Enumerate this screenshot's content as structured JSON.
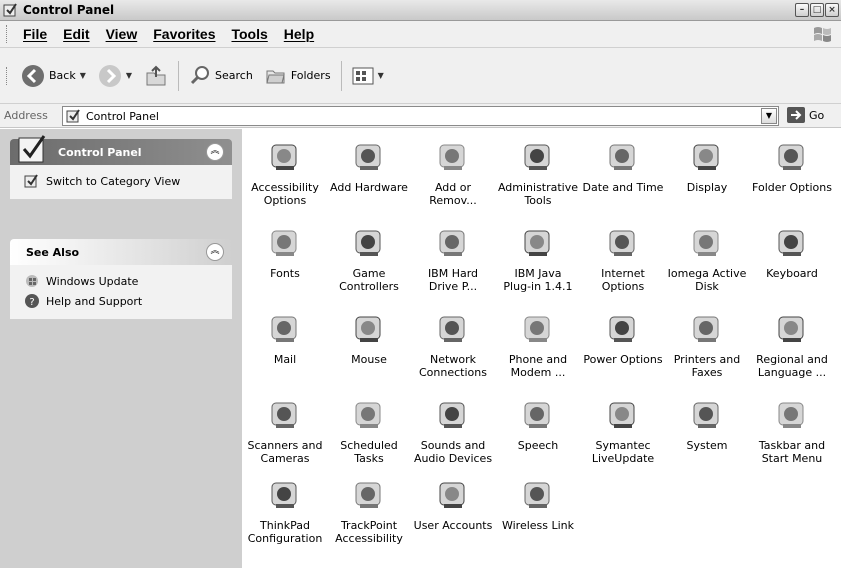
{
  "window": {
    "title": "Control Panel"
  },
  "menu": [
    "File",
    "Edit",
    "View",
    "Favorites",
    "Tools",
    "Help"
  ],
  "toolbar": {
    "back": "Back",
    "search": "Search",
    "folders": "Folders"
  },
  "address": {
    "label": "Address",
    "value": "Control Panel",
    "go": "Go"
  },
  "left": {
    "cp_title": "Control Panel",
    "switch_view": "Switch to Category View",
    "see_also": "See Also",
    "links": [
      "Windows Update",
      "Help and Support"
    ]
  },
  "items": [
    [
      "Accessibility",
      "Options"
    ],
    [
      "Add Hardware",
      ""
    ],
    [
      "Add or",
      "Remov..."
    ],
    [
      "Administrative",
      "Tools"
    ],
    [
      "Date and Time",
      ""
    ],
    [
      "Display",
      ""
    ],
    [
      "Folder Options",
      ""
    ],
    [
      "Fonts",
      ""
    ],
    [
      "Game",
      "Controllers"
    ],
    [
      "IBM Hard",
      "Drive P..."
    ],
    [
      "IBM Java",
      "Plug-in 1.4.1"
    ],
    [
      "Internet",
      "Options"
    ],
    [
      "Iomega Active",
      "Disk"
    ],
    [
      "Keyboard",
      ""
    ],
    [
      "Mail",
      ""
    ],
    [
      "Mouse",
      ""
    ],
    [
      "Network",
      "Connections"
    ],
    [
      "Phone and",
      "Modem ..."
    ],
    [
      "Power Options",
      ""
    ],
    [
      "Printers and",
      "Faxes"
    ],
    [
      "Regional and",
      "Language ..."
    ],
    [
      "Scanners and",
      "Cameras"
    ],
    [
      "Scheduled",
      "Tasks"
    ],
    [
      "Sounds and",
      "Audio Devices"
    ],
    [
      "Speech",
      ""
    ],
    [
      "Symantec",
      "LiveUpdate"
    ],
    [
      "System",
      ""
    ],
    [
      "Taskbar and",
      "Start Menu"
    ],
    [
      "ThinkPad",
      "Configuration"
    ],
    [
      "TrackPoint",
      "Accessibility"
    ],
    [
      "User Accounts",
      ""
    ],
    [
      "Wireless Link",
      ""
    ]
  ],
  "icon_names": [
    "accessibility-icon",
    "add-hardware-icon",
    "add-remove-programs-icon",
    "administrative-tools-icon",
    "date-time-icon",
    "display-icon",
    "folder-options-icon",
    "fonts-icon",
    "game-controllers-icon",
    "ibm-hard-drive-icon",
    "ibm-java-icon",
    "internet-options-icon",
    "iomega-disk-icon",
    "keyboard-icon",
    "mail-icon",
    "mouse-icon",
    "network-connections-icon",
    "phone-modem-icon",
    "power-options-icon",
    "printers-faxes-icon",
    "regional-language-icon",
    "scanners-cameras-icon",
    "scheduled-tasks-icon",
    "sounds-audio-icon",
    "speech-icon",
    "symantec-liveupdate-icon",
    "system-icon",
    "taskbar-start-menu-icon",
    "thinkpad-config-icon",
    "trackpoint-icon",
    "user-accounts-icon",
    "wireless-link-icon"
  ]
}
